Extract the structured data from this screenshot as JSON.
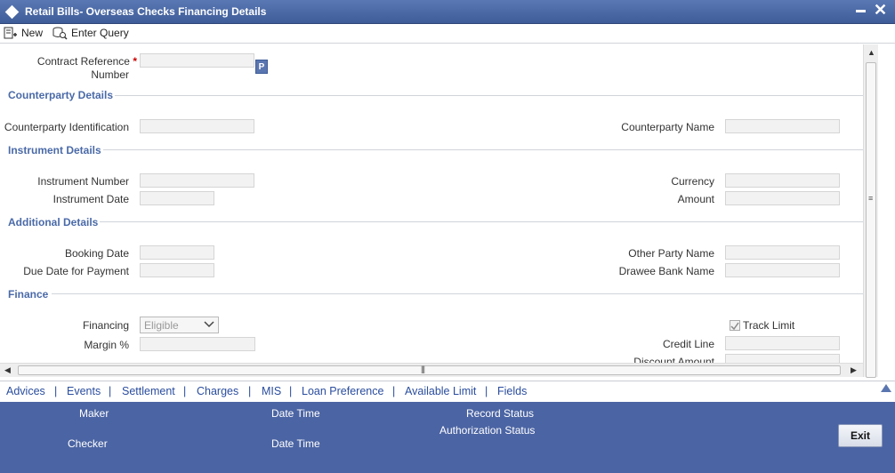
{
  "window": {
    "title": "Retail Bills- Overseas Checks Financing Details"
  },
  "toolbar": {
    "new_label": "New",
    "enter_query_label": "Enter Query"
  },
  "fields": {
    "contract_ref_line1": "Contract Reference",
    "contract_ref_required": "*",
    "contract_ref_line2": "Number",
    "p_button": "P"
  },
  "sections": {
    "counterparty": {
      "title": "Counterparty Details",
      "id_label": "Counterparty Identification",
      "name_label": "Counterparty Name"
    },
    "instrument": {
      "title": "Instrument Details",
      "number_label": "Instrument Number",
      "date_label": "Instrument Date",
      "currency_label": "Currency",
      "amount_label": "Amount"
    },
    "additional": {
      "title": "Additional Details",
      "booking_date_label": "Booking Date",
      "due_date_label": "Due Date for Payment",
      "other_party_label": "Other Party Name",
      "drawee_bank_label": "Drawee Bank Name"
    },
    "finance": {
      "title": "Finance",
      "financing_label": "Financing",
      "financing_value": "Eligible",
      "margin_label": "Margin %",
      "track_limit_label": "Track Limit",
      "track_limit_checked": true,
      "credit_line_label": "Credit Line",
      "discount_amount_label": "Discount Amount"
    }
  },
  "links": [
    "Advices",
    "Events",
    "Settlement",
    "Charges",
    "MIS",
    "Loan Preference",
    "Available Limit",
    "Fields"
  ],
  "footer": {
    "maker_label": "Maker",
    "checker_label": "Checker",
    "date_time_label_1": "Date Time",
    "date_time_label_2": "Date Time",
    "record_status_label": "Record Status",
    "authorization_status_label": "Authorization Status",
    "exit_label": "Exit"
  },
  "colors": {
    "title_bar": "#4a68a6",
    "section_title": "#4a6aa8",
    "footer_bg": "#4b64a3",
    "link": "#2a4d9e"
  }
}
